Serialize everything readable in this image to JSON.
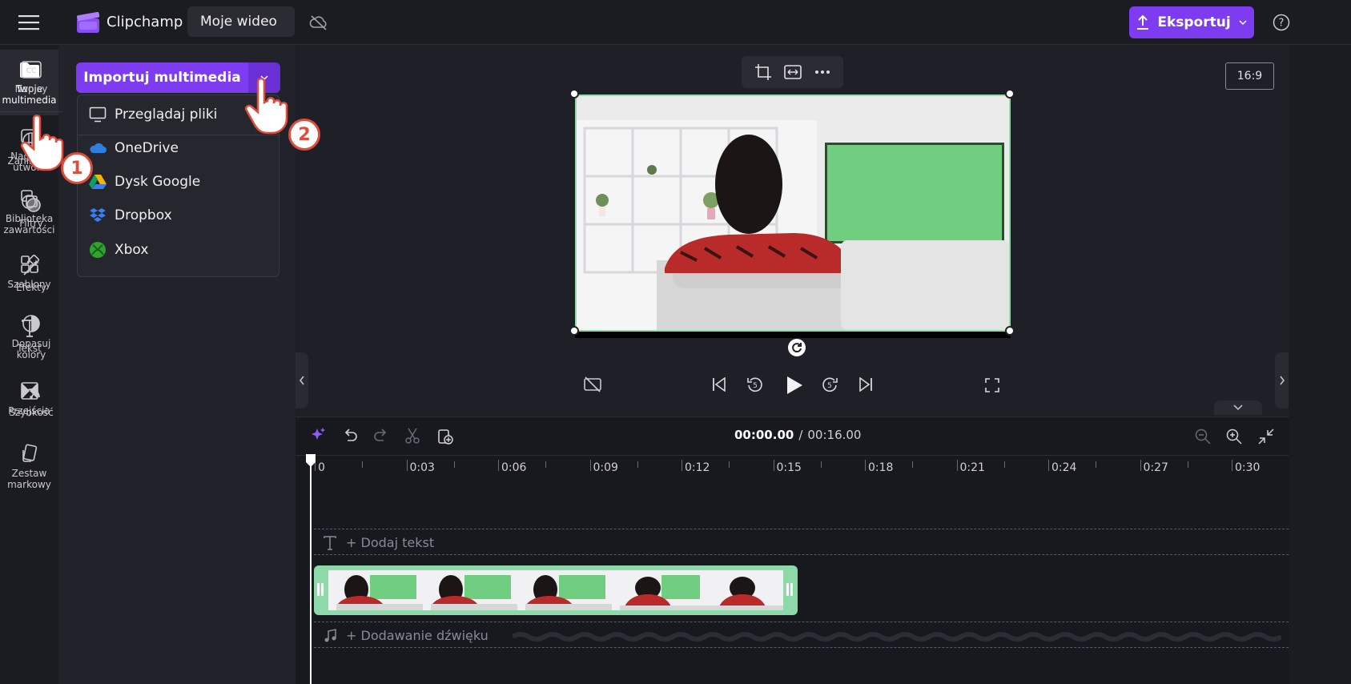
{
  "app": {
    "brand_name": "Clipchamp",
    "project_title": "Moje wideo"
  },
  "header": {
    "export_label": "Eksportuj"
  },
  "left_nav": [
    {
      "label": "Twoje multimedia",
      "icon": "folder-icon",
      "active": true
    },
    {
      "label": "Nagraj i utwórz",
      "icon": "record-icon"
    },
    {
      "label": "Biblioteka zawartości",
      "icon": "library-icon"
    },
    {
      "label": "Szablony",
      "icon": "templates-icon"
    },
    {
      "label": "Tekst",
      "icon": "text-icon"
    },
    {
      "label": "Przejścia",
      "icon": "transitions-icon"
    },
    {
      "label": "Zestaw markowy",
      "icon": "brand-kit-icon"
    }
  ],
  "media": {
    "import_label": "Importuj multimedia",
    "dropdown": [
      {
        "label": "Przeglądaj pliki",
        "icon": "monitor-icon"
      },
      {
        "label": "OneDrive",
        "icon": "onedrive-icon"
      },
      {
        "label": "Dysk Google",
        "icon": "google-drive-icon"
      },
      {
        "label": "Dropbox",
        "icon": "dropbox-icon"
      },
      {
        "label": "Xbox",
        "icon": "xbox-icon"
      }
    ]
  },
  "preview": {
    "aspect_ratio": "16:9"
  },
  "right_nav": [
    {
      "label": "Napisy",
      "icon": "captions-icon"
    },
    {
      "label": "Zanikanie",
      "icon": "fade-icon"
    },
    {
      "label": "Filtry",
      "icon": "filters-icon"
    },
    {
      "label": "Efekty",
      "icon": "effects-icon"
    },
    {
      "label": "Dopasuj kolory",
      "icon": "adjust-colors-icon"
    },
    {
      "label": "Szybkość",
      "icon": "speed-icon"
    }
  ],
  "timeline": {
    "current_time": "00:00.00",
    "separator": "/",
    "total_time": "00:16.00",
    "ruler": [
      "0",
      "0:03",
      "0:06",
      "0:09",
      "0:12",
      "0:15",
      "0:18",
      "0:21",
      "0:24",
      "0:27",
      "0:30"
    ],
    "add_text_label": "+ Dodaj tekst",
    "add_audio_label": "+ Dodawanie dźwięku"
  },
  "annotations": {
    "step1": "1",
    "step2": "2"
  },
  "colors": {
    "accent": "#7e3cf0",
    "clip": "#8dd9a9",
    "background": "#1f1f27"
  }
}
